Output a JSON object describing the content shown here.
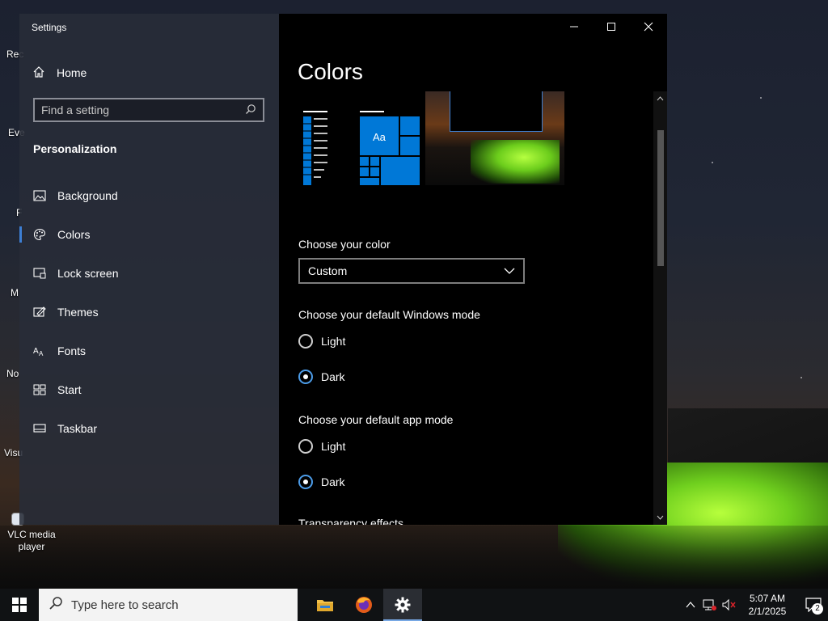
{
  "desktop": {
    "icons": [
      {
        "label": "Rec"
      },
      {
        "label": "Eve"
      },
      {
        "label": "F"
      },
      {
        "label": "M"
      },
      {
        "label": "No"
      },
      {
        "label": "Visu"
      },
      {
        "label": "VLC media player"
      }
    ]
  },
  "window": {
    "app_title": "Settings",
    "caption": {
      "minimize": "—",
      "maximize": "☐",
      "close": "✕"
    }
  },
  "sidebar": {
    "home_label": "Home",
    "search_placeholder": "Find a setting",
    "section_heading": "Personalization",
    "items": [
      {
        "label": "Background",
        "icon": "picture-icon",
        "active": false
      },
      {
        "label": "Colors",
        "icon": "palette-icon",
        "active": true
      },
      {
        "label": "Lock screen",
        "icon": "lock-screen-icon",
        "active": false
      },
      {
        "label": "Themes",
        "icon": "themes-icon",
        "active": false
      },
      {
        "label": "Fonts",
        "icon": "fonts-icon",
        "active": false
      },
      {
        "label": "Start",
        "icon": "start-icon",
        "active": false
      },
      {
        "label": "Taskbar",
        "icon": "taskbar-icon",
        "active": false
      }
    ]
  },
  "main": {
    "title": "Colors",
    "preview": {
      "tile_text": "Aa",
      "accent": "#0078d7"
    },
    "choose_color_label": "Choose your color",
    "choose_color_value": "Custom",
    "windows_mode_label": "Choose your default Windows mode",
    "windows_mode_options": [
      {
        "label": "Light",
        "selected": false
      },
      {
        "label": "Dark",
        "selected": true
      }
    ],
    "app_mode_label": "Choose your default app mode",
    "app_mode_options": [
      {
        "label": "Light",
        "selected": false
      },
      {
        "label": "Dark",
        "selected": true
      }
    ],
    "next_section_label": "Transparency effects"
  },
  "taskbar": {
    "search_placeholder": "Type here to search",
    "apps": [
      {
        "name": "file-explorer-icon"
      },
      {
        "name": "firefox-icon"
      },
      {
        "name": "settings-gear-icon",
        "active": true
      }
    ],
    "clock_time": "5:07 AM",
    "clock_date": "2/1/2025",
    "notification_count": "2"
  },
  "colors": {
    "accent": "#0078d7",
    "selection_bar": "#3d7fd4",
    "radio_selected": "#4c9ce8"
  }
}
